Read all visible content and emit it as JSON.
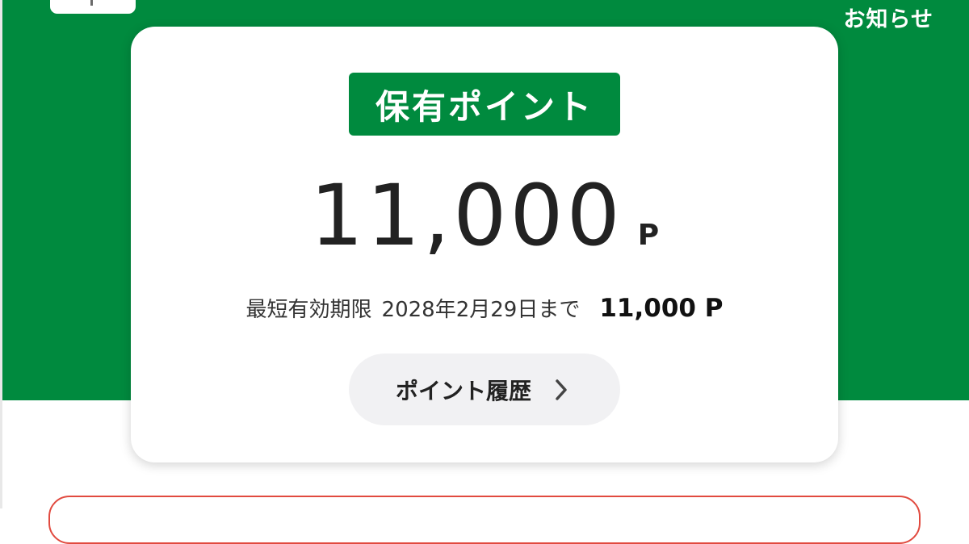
{
  "header": {
    "notice_label": "お知らせ"
  },
  "card": {
    "badge_label": "保有ポイント",
    "points_value": "11,000",
    "points_unit": "P",
    "expiry_label": "最短有効期限",
    "expiry_date": "2028年2月29日まで",
    "expiry_amount": "11,000 P",
    "history_button_label": "ポイント履歴"
  },
  "colors": {
    "brand_green": "#008a3e",
    "alert_red": "#e14a3f",
    "button_gray": "#f1f1f3"
  },
  "icons": {
    "history_chevron": "chevron-right-icon"
  }
}
